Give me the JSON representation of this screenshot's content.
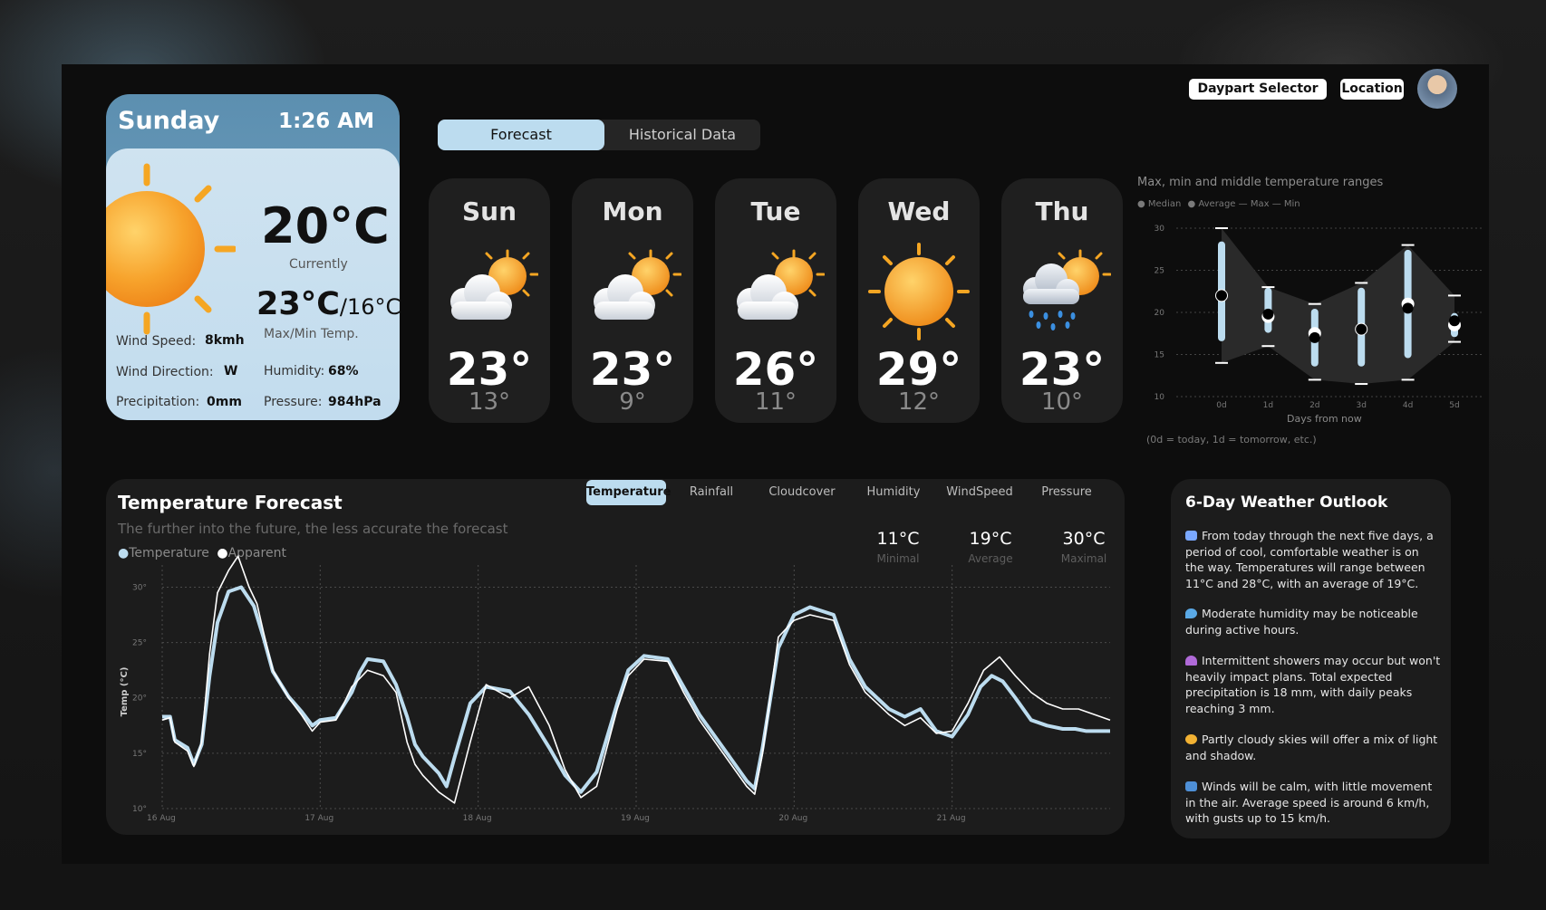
{
  "current": {
    "day": "Sunday",
    "time": "1:26 AM",
    "temp": "20°C",
    "temp_label": "Currently",
    "max": "23°C",
    "min": "/16°C",
    "maxmin_label": "Max/Min  Temp.",
    "wind_speed_label": "Wind Speed:",
    "wind_speed": "8kmh",
    "wind_dir_label": "Wind Direction:",
    "wind_dir": "W",
    "precip_label": "Precipitation:",
    "precip": "0mm",
    "humidity_label": "Humidity:",
    "humidity": "68%",
    "pressure_label": "Pressure:",
    "pressure": "984hPa",
    "icon": "sun-icon"
  },
  "tabs": [
    {
      "label": "Forecast"
    },
    {
      "label": "Historical Data"
    }
  ],
  "days": [
    {
      "name": "Sun",
      "hi": "23°",
      "lo": "13°",
      "icon": "partly-cloudy-icon"
    },
    {
      "name": "Mon",
      "hi": "23°",
      "lo": "9°",
      "icon": "partly-cloudy-icon"
    },
    {
      "name": "Tue",
      "hi": "26°",
      "lo": "11°",
      "icon": "partly-cloudy-icon"
    },
    {
      "name": "Wed",
      "hi": "29°",
      "lo": "12°",
      "icon": "sun-icon"
    },
    {
      "name": "Thu",
      "hi": "23°",
      "lo": "10°",
      "icon": "cloud-rain-sun-icon"
    }
  ],
  "topbar": {
    "daypart": "Daypart Selector",
    "location": "Location",
    "avatar": "avatar"
  },
  "range_chart": {
    "title": "Max, min and middle temperature ranges",
    "legend": [
      "Median",
      "Average",
      "Max",
      "Min"
    ],
    "xlabel": "Days from now",
    "note": "(0d = today, 1d = tomorrow, etc.)",
    "y_ticks": [
      "30",
      "25",
      "20",
      "15",
      "10"
    ],
    "x_ticks": [
      "0d",
      "1d",
      "2d",
      "3d",
      "4d",
      "5d"
    ]
  },
  "forecast_panel": {
    "title": "Temperature Forecast",
    "subtitle": "The further into the future, the less accurate the forecast",
    "legend": [
      "Temperature",
      "Apparent"
    ],
    "metric_tabs": [
      "Temperature",
      "Rainfall",
      "Cloudcover",
      "Humidity",
      "WindSpeed",
      "Pressure"
    ],
    "kpis": [
      {
        "value": "11°C",
        "label": "Minimal"
      },
      {
        "value": "19°C",
        "label": "Average"
      },
      {
        "value": "30°C",
        "label": "Maximal"
      }
    ],
    "ylabel": "Temp (°C)",
    "y_ticks": [
      "30°",
      "25°",
      "20°",
      "15°",
      "10°"
    ],
    "x_ticks": [
      "16 Aug",
      "17 Aug",
      "18 Aug",
      "19 Aug",
      "20 Aug",
      "21 Aug"
    ]
  },
  "outlook": {
    "title": "6-Day Weather Outlook",
    "items": [
      {
        "icon": "calendar-icon",
        "color": "#7aa8ff",
        "text": "From today through the next five days, a period of cool, comfortable weather is on the way. Temperatures will range between 11°C and 28°C, with an average of 19°C."
      },
      {
        "icon": "droplet-icon",
        "color": "#5aa9e6",
        "text": "Moderate humidity may be noticeable during active hours."
      },
      {
        "icon": "umbrella-icon",
        "color": "#b06ad8",
        "text": "Intermittent showers may occur but won't heavily impact plans. Total expected precipitation is 18 mm, with daily peaks reaching 3 mm."
      },
      {
        "icon": "partly-cloudy-icon",
        "color": "#f2b233",
        "text": "Partly cloudy skies will offer a mix of light and shadow."
      },
      {
        "icon": "wind-icon",
        "color": "#4e8fd6",
        "text": "Winds will be calm, with little movement in the air. Average speed is around 6 km/h, with gusts up to 15 km/h."
      }
    ]
  },
  "chart_data": [
    {
      "type": "line",
      "title": "Max, min and middle temperature ranges",
      "categories": [
        "0d",
        "1d",
        "2d",
        "3d",
        "4d",
        "5d"
      ],
      "series": [
        {
          "name": "Median",
          "values": [
            22,
            19.5,
            17.5,
            18,
            21,
            18.5
          ]
        },
        {
          "name": "Average",
          "values": [
            22,
            19.8,
            17,
            18,
            20.5,
            19
          ]
        },
        {
          "name": "Max",
          "values": [
            30,
            23,
            21,
            23.5,
            28,
            22
          ]
        },
        {
          "name": "Min",
          "values": [
            14,
            16,
            12,
            11.5,
            12,
            16.5
          ]
        }
      ],
      "bar_top": [
        28,
        22.5,
        20,
        22.5,
        27,
        19.5
      ],
      "bar_bottom": [
        17,
        18,
        14,
        14,
        15,
        17.5
      ],
      "xlabel": "Days from now",
      "ylim": [
        10,
        30
      ],
      "grid": true,
      "legend": "top-left"
    },
    {
      "type": "line",
      "x": [
        "16 Aug",
        "17 Aug",
        "18 Aug",
        "19 Aug",
        "20 Aug",
        "21 Aug"
      ],
      "xlim": [
        0,
        6
      ],
      "ylim": [
        10,
        32
      ],
      "ylabel": "Temp (°C)",
      "grid": true,
      "legend": "top-left",
      "series": [
        {
          "name": "Temperature",
          "x": [
            0,
            0.05,
            0.08,
            0.16,
            0.2,
            0.25,
            0.3,
            0.35,
            0.42,
            0.5,
            0.58,
            0.64,
            0.7,
            0.8,
            0.88,
            0.95,
            1,
            1.1,
            1.2,
            1.25,
            1.3,
            1.4,
            1.48,
            1.55,
            1.6,
            1.65,
            1.75,
            1.8,
            1.85,
            1.95,
            2.05,
            2.2,
            2.32,
            2.45,
            2.55,
            2.65,
            2.75,
            2.88,
            2.95,
            3.05,
            3.2,
            3.3,
            3.4,
            3.55,
            3.7,
            3.75,
            3.8,
            3.9,
            4,
            4.1,
            4.25,
            4.35,
            4.45,
            4.6,
            4.7,
            4.8,
            4.9,
            5,
            5.1,
            5.18,
            5.25,
            5.32,
            5.4,
            5.5,
            5.6,
            5.7,
            5.78,
            5.85,
            5.95,
            6
          ],
          "values": [
            18.3,
            18.3,
            16.2,
            15.5,
            14.0,
            15.8,
            22.0,
            26.8,
            29.6,
            30.0,
            28.3,
            25.5,
            22.4,
            20.1,
            18.8,
            17.5,
            18.0,
            18.2,
            20.5,
            22.3,
            23.5,
            23.3,
            21.2,
            18.3,
            15.8,
            14.7,
            13.2,
            12.0,
            14.6,
            19.5,
            21.0,
            20.6,
            18.5,
            15.5,
            13.0,
            11.5,
            13.3,
            19.5,
            22.5,
            23.8,
            23.5,
            21.0,
            18.5,
            15.5,
            12.5,
            11.8,
            15.5,
            24.5,
            27.5,
            28.2,
            27.5,
            23.5,
            21.0,
            19.0,
            18.3,
            19.0,
            17.0,
            16.5,
            18.5,
            21.0,
            22.0,
            21.5,
            20.0,
            18.0,
            17.5,
            17.2,
            17.2,
            17.0,
            17.0,
            17.0
          ]
        },
        {
          "name": "Apparent",
          "x": [
            0,
            0.05,
            0.08,
            0.16,
            0.2,
            0.25,
            0.3,
            0.35,
            0.42,
            0.48,
            0.55,
            0.6,
            0.64,
            0.7,
            0.8,
            0.88,
            0.95,
            1,
            1.1,
            1.2,
            1.3,
            1.4,
            1.48,
            1.55,
            1.6,
            1.65,
            1.75,
            1.85,
            1.95,
            2.05,
            2.2,
            2.32,
            2.45,
            2.55,
            2.65,
            2.75,
            2.88,
            2.95,
            3.05,
            3.2,
            3.3,
            3.4,
            3.55,
            3.7,
            3.75,
            3.8,
            3.9,
            4,
            4.1,
            4.25,
            4.35,
            4.45,
            4.6,
            4.7,
            4.8,
            4.9,
            5,
            5.1,
            5.2,
            5.3,
            5.4,
            5.5,
            5.6,
            5.7,
            5.8,
            5.9,
            6
          ],
          "values": [
            18.0,
            18.2,
            16.0,
            15.2,
            13.8,
            16.0,
            24.0,
            29.5,
            31.5,
            32.8,
            30.0,
            28.5,
            26.0,
            22.5,
            20.0,
            18.5,
            17.0,
            17.8,
            18.0,
            21.0,
            22.5,
            22.0,
            20.5,
            16.0,
            14.0,
            13.0,
            11.5,
            10.5,
            16.0,
            21.2,
            20.0,
            21.0,
            17.5,
            13.5,
            11.0,
            12.0,
            19.0,
            22.0,
            23.5,
            23.3,
            20.5,
            18.0,
            15.0,
            12.0,
            11.3,
            15.0,
            25.5,
            27.0,
            27.5,
            27.0,
            23.0,
            20.5,
            18.5,
            17.5,
            18.2,
            16.8,
            17.0,
            19.5,
            22.5,
            23.7,
            22.0,
            20.5,
            19.5,
            19.0,
            19.0,
            18.5,
            18.0
          ]
        }
      ]
    }
  ]
}
